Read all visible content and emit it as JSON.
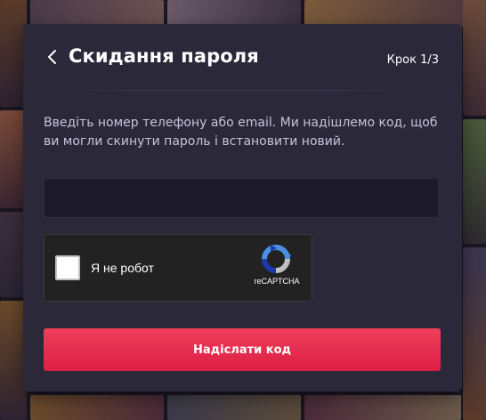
{
  "colors": {
    "modal_background": "#2a2839",
    "accent_button": "#e5294d",
    "input_background": "#1d1b29",
    "description_text": "#c9c4d8"
  },
  "header": {
    "back_icon": "chevron-left-icon",
    "title": "Скидання пароля",
    "step": "Крок 1/3"
  },
  "form": {
    "description": "Введіть номер телефону або email. Ми надішлемо код, щоб ви могли скинути пароль і встановити новий.",
    "contact_value": "",
    "contact_placeholder": ""
  },
  "recaptcha": {
    "checkbox_label": "Я не робот",
    "brand": "reCAPTCHA",
    "logo_icon": "recaptcha-logo-icon",
    "checked": false
  },
  "submit": {
    "label": "Надіслати код"
  }
}
